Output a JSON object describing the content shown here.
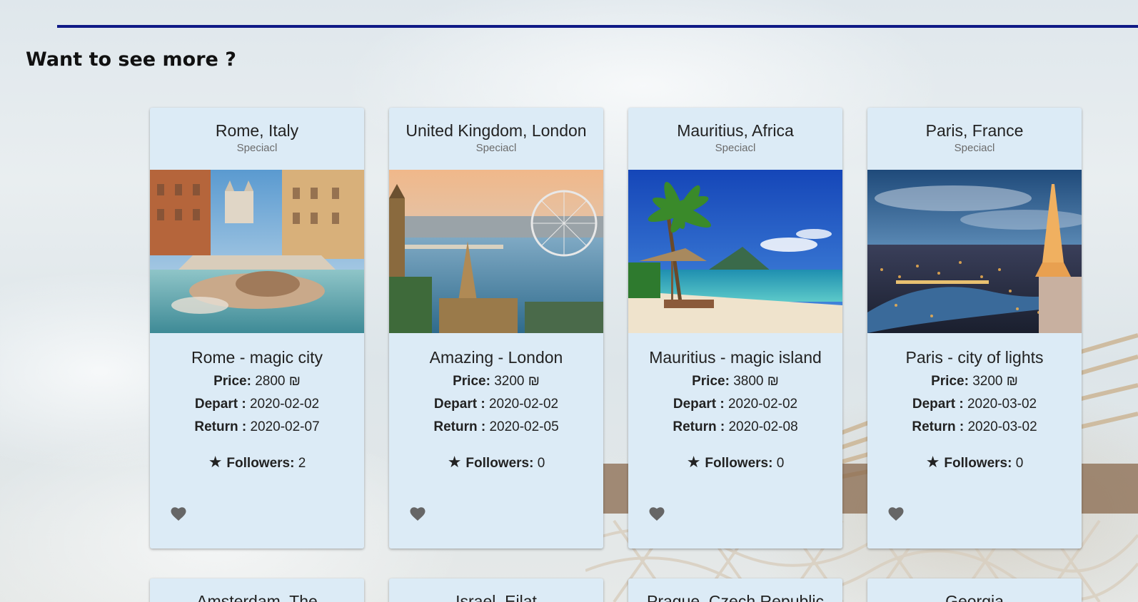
{
  "section": {
    "title": "Want to see more ?"
  },
  "cards": [
    {
      "title": "Rome, Italy",
      "subtitle": "Speciacl",
      "trip_name": "Rome - magic city",
      "price_label": "Price:",
      "price": "2800 ₪",
      "depart_label": "Depart :",
      "depart": "2020-02-02",
      "return_label": "Return :",
      "return": "2020-02-07",
      "followers_label": "Followers:",
      "followers": "2"
    },
    {
      "title": "United Kingdom, London",
      "subtitle": "Speciacl",
      "trip_name": "Amazing - London",
      "price_label": "Price:",
      "price": "3200 ₪",
      "depart_label": "Depart :",
      "depart": "2020-02-02",
      "return_label": "Return :",
      "return": "2020-02-05",
      "followers_label": "Followers:",
      "followers": "0"
    },
    {
      "title": "Mauritius, Africa",
      "subtitle": "Speciacl",
      "trip_name": "Mauritius - magic island",
      "price_label": "Price:",
      "price": "3800 ₪",
      "depart_label": "Depart :",
      "depart": "2020-02-02",
      "return_label": "Return :",
      "return": "2020-02-08",
      "followers_label": "Followers:",
      "followers": "0"
    },
    {
      "title": "Paris, France",
      "subtitle": "Speciacl",
      "trip_name": "Paris - city of lights",
      "price_label": "Price:",
      "price": "3200 ₪",
      "depart_label": "Depart :",
      "depart": "2020-03-02",
      "return_label": "Return :",
      "return": "2020-03-02",
      "followers_label": "Followers:",
      "followers": "0"
    }
  ],
  "next_row": [
    {
      "title": "Amsterdam, The"
    },
    {
      "title": "Israel, Eilat"
    },
    {
      "title": "Prague, Czech Republic"
    },
    {
      "title": "Georgia"
    }
  ],
  "icons": {
    "star": "star-icon",
    "heart": "heart-icon"
  },
  "colors": {
    "card_bg": "#dcebf6",
    "rule": "#0f1a86",
    "heart": "#666666"
  }
}
